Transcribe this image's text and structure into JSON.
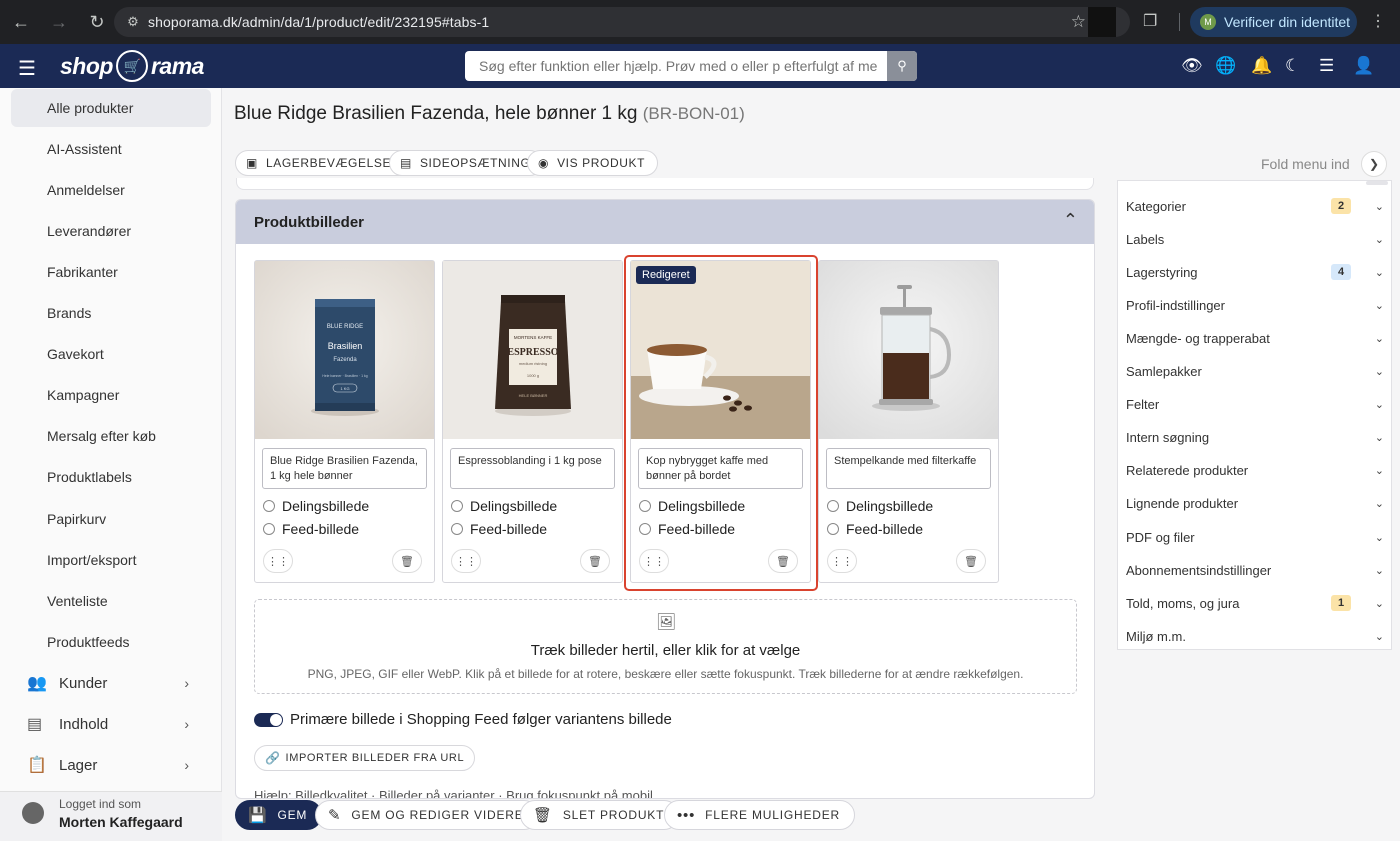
{
  "browser": {
    "url": "shoporama.dk/admin/da/1/product/edit/232195#tabs-1",
    "profile_initial": "M",
    "profile_button": "Verificer din identitet"
  },
  "header": {
    "logo_left": "shop",
    "logo_right": "rama",
    "search_placeholder": "Søg efter funktion eller hjælp. Prøv med o eller p efterfulgt af me"
  },
  "sidebar": {
    "items": [
      {
        "label": "Alle produkter",
        "active": true
      },
      {
        "label": "AI-Assistent"
      },
      {
        "label": "Anmeldelser"
      },
      {
        "label": "Leverandører"
      },
      {
        "label": "Fabrikanter"
      },
      {
        "label": "Brands"
      },
      {
        "label": "Gavekort"
      },
      {
        "label": "Kampagner"
      },
      {
        "label": "Mersalg efter køb"
      },
      {
        "label": "Produktlabels"
      },
      {
        "label": "Papirkurv"
      },
      {
        "label": "Import/eksport"
      },
      {
        "label": "Venteliste"
      },
      {
        "label": "Produktfeeds"
      }
    ],
    "groups": [
      {
        "label": "Kunder",
        "icon": "users-icon"
      },
      {
        "label": "Indhold",
        "icon": "document-icon"
      },
      {
        "label": "Lager",
        "icon": "clipboard-icon"
      }
    ],
    "login_label": "Logget ind som",
    "login_name": "Morten Kaffegaard"
  },
  "product": {
    "title": "Blue Ridge Brasilien Fazenda, hele bønner 1 kg",
    "sku": "(BR-BON-01)"
  },
  "toolbar": {
    "stock_moves": "LAGERBEVÆGELSER",
    "page_setup": "SIDEOPSÆTNING",
    "view_product": "VIS PRODUKT",
    "fold_menu": "Fold menu ind"
  },
  "images_panel": {
    "title": "Produktbilleder",
    "edited_badge": "Redigeret",
    "share_label": "Delingsbillede",
    "feed_label": "Feed-billede",
    "cards": [
      {
        "caption": "Blue Ridge Brasilien Fazenda, 1 kg hele bønner"
      },
      {
        "caption": "Espressoblanding i 1 kg pose"
      },
      {
        "caption": "Kop nybrygget kaffe med bønner på bordet"
      },
      {
        "caption": "Stempelkande med filterkaffe"
      }
    ],
    "can_label": {
      "brand": "BLUE RIDGE",
      "name": "Brasilien",
      "sub": "Fazenda",
      "small": "Hele bønner · Brasilien · 1 kg",
      "weight": "1 KG"
    },
    "bag_label": {
      "brand": "MORTENS KAFFE",
      "name": "ESPRESSO",
      "sub": "medium ristning",
      "weight": "1000 g",
      "bottom": "HELE BØNNER"
    },
    "dropzone_title": "Træk billeder hertil, eller klik for at vælge",
    "dropzone_hint": "PNG, JPEG, GIF eller WebP. Klik på et billede for at rotere, beskære eller sætte fokuspunkt. Træk billederne for at ændre rækkefølgen.",
    "toggle_label": "Primære billede i Shopping Feed følger variantens billede",
    "import_button": "IMPORTER BILLEDER FRA URL",
    "cut_text": "Hjælp: Billedkvalitet · Billeder på varianter · Brug fokuspunkt på mobil"
  },
  "right_panel": {
    "items": [
      {
        "label": "Kategorier",
        "count": "2",
        "count_color": "#fbe3a8"
      },
      {
        "label": "Labels"
      },
      {
        "label": "Lagerstyring",
        "count": "4",
        "count_color": "#d6e8fa"
      },
      {
        "label": "Profil-indstillinger"
      },
      {
        "label": "Mængde- og trapperabat"
      },
      {
        "label": "Samlepakker"
      },
      {
        "label": "Felter"
      },
      {
        "label": "Intern søgning"
      },
      {
        "label": "Relaterede produkter"
      },
      {
        "label": "Lignende produkter"
      },
      {
        "label": "PDF og filer"
      },
      {
        "label": "Abonnementsindstillinger"
      },
      {
        "label": "Told, moms, og jura",
        "count": "1",
        "count_color": "#fbe3a8"
      },
      {
        "label": "Miljø m.m."
      }
    ]
  },
  "actions": {
    "save": "GEM",
    "save_continue": "GEM OG REDIGER VIDERE",
    "delete": "SLET PRODUKT",
    "more": "FLERE MULIGHEDER"
  }
}
